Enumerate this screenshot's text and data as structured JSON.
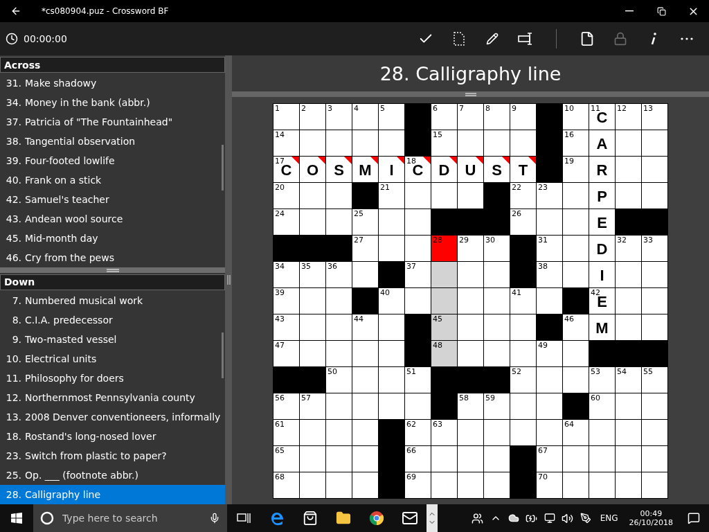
{
  "window": {
    "title": "*cs080904.puz - Crossword BF"
  },
  "toolbar": {
    "timer": "00:00:00",
    "lock_disabled": true
  },
  "across": {
    "heading": "Across",
    "clues": [
      {
        "number": "31.",
        "text": "Make shadowy",
        "selected": false
      },
      {
        "number": "34.",
        "text": "Money in the bank (abbr.)",
        "selected": false
      },
      {
        "number": "37.",
        "text": "Patricia of \"The Fountainhead\"",
        "selected": false
      },
      {
        "number": "38.",
        "text": "Tangential observation",
        "selected": false
      },
      {
        "number": "39.",
        "text": "Four-footed lowlife",
        "selected": false
      },
      {
        "number": "40.",
        "text": "Frank on a stick",
        "selected": false
      },
      {
        "number": "42.",
        "text": "Samuel's teacher",
        "selected": false
      },
      {
        "number": "43.",
        "text": "Andean wool source",
        "selected": false
      },
      {
        "number": "45.",
        "text": "Mid-month day",
        "selected": false
      },
      {
        "number": "46.",
        "text": "Cry from the pews",
        "selected": false
      }
    ]
  },
  "down": {
    "heading": "Down",
    "clues": [
      {
        "number": "7.",
        "text": "Numbered musical work",
        "selected": false
      },
      {
        "number": "8.",
        "text": "C.I.A. predecessor",
        "selected": false
      },
      {
        "number": "9.",
        "text": "Two-masted vessel",
        "selected": false
      },
      {
        "number": "10.",
        "text": "Electrical units",
        "selected": false
      },
      {
        "number": "11.",
        "text": "Philosophy for doers",
        "selected": false
      },
      {
        "number": "12.",
        "text": "Northernmost Pennsylvania county",
        "selected": false
      },
      {
        "number": "13.",
        "text": "2008 Denver conventioneers, informally",
        "selected": false
      },
      {
        "number": "18.",
        "text": "Rostand's long-nosed lover",
        "selected": false
      },
      {
        "number": "23.",
        "text": "Switch from plastic to paper?",
        "selected": false
      },
      {
        "number": "25.",
        "text": "Op. ___ (footnote abbr.)",
        "selected": false
      },
      {
        "number": "28.",
        "text": "Calligraphy line",
        "selected": true
      }
    ]
  },
  "current_clue": "28. Calligraphy line",
  "grid": {
    "rows": [
      [
        {
          "kind": "cell",
          "number": "1",
          "selected": false,
          "highlighted": false,
          "flagged": false
        },
        {
          "kind": "cell",
          "number": "2",
          "selected": false,
          "highlighted": false,
          "flagged": false
        },
        {
          "kind": "cell",
          "number": "3",
          "selected": false,
          "highlighted": false,
          "flagged": false
        },
        {
          "kind": "cell",
          "number": "4",
          "selected": false,
          "highlighted": false,
          "flagged": false
        },
        {
          "kind": "cell",
          "number": "5",
          "selected": false,
          "highlighted": false,
          "flagged": false
        },
        {
          "kind": "block"
        },
        {
          "kind": "cell",
          "number": "6",
          "selected": false,
          "highlighted": false,
          "flagged": false
        },
        {
          "kind": "cell",
          "number": "7",
          "selected": false,
          "highlighted": false,
          "flagged": false
        },
        {
          "kind": "cell",
          "number": "8",
          "selected": false,
          "highlighted": false,
          "flagged": false
        },
        {
          "kind": "cell",
          "number": "9",
          "selected": false,
          "highlighted": false,
          "flagged": false
        },
        {
          "kind": "block"
        },
        {
          "kind": "cell",
          "number": "10",
          "selected": false,
          "highlighted": false,
          "flagged": false
        },
        {
          "kind": "cell",
          "number": "11",
          "letter": "C",
          "selected": false,
          "highlighted": false,
          "flagged": false
        },
        {
          "kind": "cell",
          "number": "12",
          "selected": false,
          "highlighted": false,
          "flagged": false
        },
        {
          "kind": "cell",
          "number": "13",
          "selected": false,
          "highlighted": false,
          "flagged": false
        }
      ],
      [
        {
          "kind": "cell",
          "number": "14",
          "selected": false,
          "highlighted": false,
          "flagged": false
        },
        {
          "kind": "cell",
          "selected": false,
          "highlighted": false,
          "flagged": false
        },
        {
          "kind": "cell",
          "selected": false,
          "highlighted": false,
          "flagged": false
        },
        {
          "kind": "cell",
          "selected": false,
          "highlighted": false,
          "flagged": false
        },
        {
          "kind": "cell",
          "selected": false,
          "highlighted": false,
          "flagged": false
        },
        {
          "kind": "block"
        },
        {
          "kind": "cell",
          "number": "15",
          "selected": false,
          "highlighted": false,
          "flagged": false
        },
        {
          "kind": "cell",
          "selected": false,
          "highlighted": false,
          "flagged": false
        },
        {
          "kind": "cell",
          "selected": false,
          "highlighted": false,
          "flagged": false
        },
        {
          "kind": "cell",
          "selected": false,
          "highlighted": false,
          "flagged": false
        },
        {
          "kind": "block"
        },
        {
          "kind": "cell",
          "number": "16",
          "selected": false,
          "highlighted": false,
          "flagged": false
        },
        {
          "kind": "cell",
          "letter": "A",
          "selected": false,
          "highlighted": false,
          "flagged": false
        },
        {
          "kind": "cell",
          "selected": false,
          "highlighted": false,
          "flagged": false
        },
        {
          "kind": "cell",
          "selected": false,
          "highlighted": false,
          "flagged": false
        }
      ],
      [
        {
          "kind": "cell",
          "number": "17",
          "letter": "C",
          "selected": false,
          "highlighted": false,
          "flagged": true
        },
        {
          "kind": "cell",
          "letter": "O",
          "selected": false,
          "highlighted": false,
          "flagged": true
        },
        {
          "kind": "cell",
          "letter": "S",
          "selected": false,
          "highlighted": false,
          "flagged": true
        },
        {
          "kind": "cell",
          "letter": "M",
          "selected": false,
          "highlighted": false,
          "flagged": true
        },
        {
          "kind": "cell",
          "letter": "I",
          "selected": false,
          "highlighted": false,
          "flagged": true
        },
        {
          "kind": "cell",
          "number": "18",
          "letter": "C",
          "selected": false,
          "highlighted": false,
          "flagged": true
        },
        {
          "kind": "cell",
          "letter": "D",
          "selected": false,
          "highlighted": false,
          "flagged": true
        },
        {
          "kind": "cell",
          "letter": "U",
          "selected": false,
          "highlighted": false,
          "flagged": true
        },
        {
          "kind": "cell",
          "letter": "S",
          "selected": false,
          "highlighted": false,
          "flagged": true
        },
        {
          "kind": "cell",
          "letter": "T",
          "selected": false,
          "highlighted": false,
          "flagged": true
        },
        {
          "kind": "block"
        },
        {
          "kind": "cell",
          "number": "19",
          "selected": false,
          "highlighted": false,
          "flagged": false
        },
        {
          "kind": "cell",
          "letter": "R",
          "selected": false,
          "highlighted": false,
          "flagged": false
        },
        {
          "kind": "cell",
          "selected": false,
          "highlighted": false,
          "flagged": false
        },
        {
          "kind": "cell",
          "selected": false,
          "highlighted": false,
          "flagged": false
        }
      ],
      [
        {
          "kind": "cell",
          "number": "20",
          "selected": false,
          "highlighted": false,
          "flagged": false
        },
        {
          "kind": "cell",
          "selected": false,
          "highlighted": false,
          "flagged": false
        },
        {
          "kind": "cell",
          "selected": false,
          "highlighted": false,
          "flagged": false
        },
        {
          "kind": "block"
        },
        {
          "kind": "cell",
          "number": "21",
          "selected": false,
          "highlighted": false,
          "flagged": false
        },
        {
          "kind": "cell",
          "selected": false,
          "highlighted": false,
          "flagged": false
        },
        {
          "kind": "cell",
          "selected": false,
          "highlighted": false,
          "flagged": false
        },
        {
          "kind": "cell",
          "selected": false,
          "highlighted": false,
          "flagged": false
        },
        {
          "kind": "block"
        },
        {
          "kind": "cell",
          "number": "22",
          "selected": false,
          "highlighted": false,
          "flagged": false
        },
        {
          "kind": "cell",
          "number": "23",
          "selected": false,
          "highlighted": false,
          "flagged": false
        },
        {
          "kind": "cell",
          "selected": false,
          "highlighted": false,
          "flagged": false
        },
        {
          "kind": "cell",
          "letter": "P",
          "selected": false,
          "highlighted": false,
          "flagged": false
        },
        {
          "kind": "cell",
          "selected": false,
          "highlighted": false,
          "flagged": false
        },
        {
          "kind": "cell",
          "selected": false,
          "highlighted": false,
          "flagged": false
        }
      ],
      [
        {
          "kind": "cell",
          "number": "24",
          "selected": false,
          "highlighted": false,
          "flagged": false
        },
        {
          "kind": "cell",
          "selected": false,
          "highlighted": false,
          "flagged": false
        },
        {
          "kind": "cell",
          "selected": false,
          "highlighted": false,
          "flagged": false
        },
        {
          "kind": "cell",
          "number": "25",
          "selected": false,
          "highlighted": false,
          "flagged": false
        },
        {
          "kind": "cell",
          "selected": false,
          "highlighted": false,
          "flagged": false
        },
        {
          "kind": "cell",
          "selected": false,
          "highlighted": false,
          "flagged": false
        },
        {
          "kind": "block"
        },
        {
          "kind": "block"
        },
        {
          "kind": "block"
        },
        {
          "kind": "cell",
          "number": "26",
          "selected": false,
          "highlighted": false,
          "flagged": false
        },
        {
          "kind": "cell",
          "selected": false,
          "highlighted": false,
          "flagged": false
        },
        {
          "kind": "cell",
          "selected": false,
          "highlighted": false,
          "flagged": false
        },
        {
          "kind": "cell",
          "letter": "E",
          "selected": false,
          "highlighted": false,
          "flagged": false
        },
        {
          "kind": "block"
        },
        {
          "kind": "block"
        }
      ],
      [
        {
          "kind": "block"
        },
        {
          "kind": "block"
        },
        {
          "kind": "block"
        },
        {
          "kind": "cell",
          "number": "27",
          "selected": false,
          "highlighted": false,
          "flagged": false
        },
        {
          "kind": "cell",
          "selected": false,
          "highlighted": false,
          "flagged": false
        },
        {
          "kind": "cell",
          "selected": false,
          "highlighted": false,
          "flagged": false
        },
        {
          "kind": "cell",
          "number": "28",
          "selected": true,
          "highlighted": false,
          "flagged": false
        },
        {
          "kind": "cell",
          "number": "29",
          "selected": false,
          "highlighted": false,
          "flagged": false
        },
        {
          "kind": "cell",
          "number": "30",
          "selected": false,
          "highlighted": false,
          "flagged": false
        },
        {
          "kind": "block"
        },
        {
          "kind": "cell",
          "number": "31",
          "selected": false,
          "highlighted": false,
          "flagged": false
        },
        {
          "kind": "cell",
          "selected": false,
          "highlighted": false,
          "flagged": false
        },
        {
          "kind": "cell",
          "letter": "D",
          "selected": false,
          "highlighted": false,
          "flagged": false
        },
        {
          "kind": "cell",
          "number": "32",
          "selected": false,
          "highlighted": false,
          "flagged": false
        },
        {
          "kind": "cell",
          "number": "33",
          "selected": false,
          "highlighted": false,
          "flagged": false
        }
      ],
      [
        {
          "kind": "cell",
          "number": "34",
          "selected": false,
          "highlighted": false,
          "flagged": false
        },
        {
          "kind": "cell",
          "number": "35",
          "selected": false,
          "highlighted": false,
          "flagged": false
        },
        {
          "kind": "cell",
          "number": "36",
          "selected": false,
          "highlighted": false,
          "flagged": false
        },
        {
          "kind": "cell",
          "selected": false,
          "highlighted": false,
          "flagged": false
        },
        {
          "kind": "block"
        },
        {
          "kind": "cell",
          "number": "37",
          "selected": false,
          "highlighted": false,
          "flagged": false
        },
        {
          "kind": "cell",
          "selected": false,
          "highlighted": true,
          "flagged": false
        },
        {
          "kind": "cell",
          "selected": false,
          "highlighted": false,
          "flagged": false
        },
        {
          "kind": "cell",
          "selected": false,
          "highlighted": false,
          "flagged": false
        },
        {
          "kind": "block"
        },
        {
          "kind": "cell",
          "number": "38",
          "selected": false,
          "highlighted": false,
          "flagged": false
        },
        {
          "kind": "cell",
          "selected": false,
          "highlighted": false,
          "flagged": false
        },
        {
          "kind": "cell",
          "letter": "I",
          "selected": false,
          "highlighted": false,
          "flagged": false
        },
        {
          "kind": "cell",
          "selected": false,
          "highlighted": false,
          "flagged": false
        },
        {
          "kind": "cell",
          "selected": false,
          "highlighted": false,
          "flagged": false
        }
      ],
      [
        {
          "kind": "cell",
          "number": "39",
          "selected": false,
          "highlighted": false,
          "flagged": false
        },
        {
          "kind": "cell",
          "selected": false,
          "highlighted": false,
          "flagged": false
        },
        {
          "kind": "cell",
          "selected": false,
          "highlighted": false,
          "flagged": false
        },
        {
          "kind": "block"
        },
        {
          "kind": "cell",
          "number": "40",
          "selected": false,
          "highlighted": false,
          "flagged": false
        },
        {
          "kind": "cell",
          "selected": false,
          "highlighted": false,
          "flagged": false
        },
        {
          "kind": "cell",
          "selected": false,
          "highlighted": true,
          "flagged": false
        },
        {
          "kind": "cell",
          "selected": false,
          "highlighted": false,
          "flagged": false
        },
        {
          "kind": "cell",
          "selected": false,
          "highlighted": false,
          "flagged": false
        },
        {
          "kind": "cell",
          "number": "41",
          "selected": false,
          "highlighted": false,
          "flagged": false
        },
        {
          "kind": "cell",
          "selected": false,
          "highlighted": false,
          "flagged": false
        },
        {
          "kind": "block"
        },
        {
          "kind": "cell",
          "number": "42",
          "letter": "E",
          "selected": false,
          "highlighted": false,
          "flagged": false
        },
        {
          "kind": "cell",
          "selected": false,
          "highlighted": false,
          "flagged": false
        },
        {
          "kind": "cell",
          "selected": false,
          "highlighted": false,
          "flagged": false
        }
      ],
      [
        {
          "kind": "cell",
          "number": "43",
          "selected": false,
          "highlighted": false,
          "flagged": false
        },
        {
          "kind": "cell",
          "selected": false,
          "highlighted": false,
          "flagged": false
        },
        {
          "kind": "cell",
          "selected": false,
          "highlighted": false,
          "flagged": false
        },
        {
          "kind": "cell",
          "number": "44",
          "selected": false,
          "highlighted": false,
          "flagged": false
        },
        {
          "kind": "cell",
          "selected": false,
          "highlighted": false,
          "flagged": false
        },
        {
          "kind": "block"
        },
        {
          "kind": "cell",
          "number": "45",
          "selected": false,
          "highlighted": true,
          "flagged": false
        },
        {
          "kind": "cell",
          "selected": false,
          "highlighted": false,
          "flagged": false
        },
        {
          "kind": "cell",
          "selected": false,
          "highlighted": false,
          "flagged": false
        },
        {
          "kind": "cell",
          "selected": false,
          "highlighted": false,
          "flagged": false
        },
        {
          "kind": "block"
        },
        {
          "kind": "cell",
          "number": "46",
          "selected": false,
          "highlighted": false,
          "flagged": false
        },
        {
          "kind": "cell",
          "letter": "M",
          "selected": false,
          "highlighted": false,
          "flagged": false
        },
        {
          "kind": "cell",
          "selected": false,
          "highlighted": false,
          "flagged": false
        },
        {
          "kind": "cell",
          "selected": false,
          "highlighted": false,
          "flagged": false
        }
      ],
      [
        {
          "kind": "cell",
          "number": "47",
          "selected": false,
          "highlighted": false,
          "flagged": false
        },
        {
          "kind": "cell",
          "selected": false,
          "highlighted": false,
          "flagged": false
        },
        {
          "kind": "cell",
          "selected": false,
          "highlighted": false,
          "flagged": false
        },
        {
          "kind": "cell",
          "selected": false,
          "highlighted": false,
          "flagged": false
        },
        {
          "kind": "cell",
          "selected": false,
          "highlighted": false,
          "flagged": false
        },
        {
          "kind": "block"
        },
        {
          "kind": "cell",
          "number": "48",
          "selected": false,
          "highlighted": true,
          "flagged": false
        },
        {
          "kind": "cell",
          "selected": false,
          "highlighted": false,
          "flagged": false
        },
        {
          "kind": "cell",
          "selected": false,
          "highlighted": false,
          "flagged": false
        },
        {
          "kind": "cell",
          "selected": false,
          "highlighted": false,
          "flagged": false
        },
        {
          "kind": "cell",
          "number": "49",
          "selected": false,
          "highlighted": false,
          "flagged": false
        },
        {
          "kind": "cell",
          "selected": false,
          "highlighted": false,
          "flagged": false
        },
        {
          "kind": "block"
        },
        {
          "kind": "block"
        },
        {
          "kind": "block"
        }
      ],
      [
        {
          "kind": "block"
        },
        {
          "kind": "block"
        },
        {
          "kind": "cell",
          "number": "50",
          "selected": false,
          "highlighted": false,
          "flagged": false
        },
        {
          "kind": "cell",
          "selected": false,
          "highlighted": false,
          "flagged": false
        },
        {
          "kind": "cell",
          "selected": false,
          "highlighted": false,
          "flagged": false
        },
        {
          "kind": "cell",
          "number": "51",
          "selected": false,
          "highlighted": false,
          "flagged": false
        },
        {
          "kind": "block"
        },
        {
          "kind": "block"
        },
        {
          "kind": "block"
        },
        {
          "kind": "cell",
          "number": "52",
          "selected": false,
          "highlighted": false,
          "flagged": false
        },
        {
          "kind": "cell",
          "selected": false,
          "highlighted": false,
          "flagged": false
        },
        {
          "kind": "cell",
          "selected": false,
          "highlighted": false,
          "flagged": false
        },
        {
          "kind": "cell",
          "number": "53",
          "selected": false,
          "highlighted": false,
          "flagged": false
        },
        {
          "kind": "cell",
          "number": "54",
          "selected": false,
          "highlighted": false,
          "flagged": false
        },
        {
          "kind": "cell",
          "number": "55",
          "selected": false,
          "highlighted": false,
          "flagged": false
        }
      ],
      [
        {
          "kind": "cell",
          "number": "56",
          "selected": false,
          "highlighted": false,
          "flagged": false
        },
        {
          "kind": "cell",
          "number": "57",
          "selected": false,
          "highlighted": false,
          "flagged": false
        },
        {
          "kind": "cell",
          "selected": false,
          "highlighted": false,
          "flagged": false
        },
        {
          "kind": "cell",
          "selected": false,
          "highlighted": false,
          "flagged": false
        },
        {
          "kind": "cell",
          "selected": false,
          "highlighted": false,
          "flagged": false
        },
        {
          "kind": "cell",
          "selected": false,
          "highlighted": false,
          "flagged": false
        },
        {
          "kind": "block"
        },
        {
          "kind": "cell",
          "number": "58",
          "selected": false,
          "highlighted": false,
          "flagged": false
        },
        {
          "kind": "cell",
          "number": "59",
          "selected": false,
          "highlighted": false,
          "flagged": false
        },
        {
          "kind": "cell",
          "selected": false,
          "highlighted": false,
          "flagged": false
        },
        {
          "kind": "cell",
          "selected": false,
          "highlighted": false,
          "flagged": false
        },
        {
          "kind": "block"
        },
        {
          "kind": "cell",
          "number": "60",
          "selected": false,
          "highlighted": false,
          "flagged": false
        },
        {
          "kind": "cell",
          "selected": false,
          "highlighted": false,
          "flagged": false
        },
        {
          "kind": "cell",
          "selected": false,
          "highlighted": false,
          "flagged": false
        }
      ],
      [
        {
          "kind": "cell",
          "number": "61",
          "selected": false,
          "highlighted": false,
          "flagged": false
        },
        {
          "kind": "cell",
          "selected": false,
          "highlighted": false,
          "flagged": false
        },
        {
          "kind": "cell",
          "selected": false,
          "highlighted": false,
          "flagged": false
        },
        {
          "kind": "cell",
          "selected": false,
          "highlighted": false,
          "flagged": false
        },
        {
          "kind": "block"
        },
        {
          "kind": "cell",
          "number": "62",
          "selected": false,
          "highlighted": false,
          "flagged": false
        },
        {
          "kind": "cell",
          "number": "63",
          "selected": false,
          "highlighted": false,
          "flagged": false
        },
        {
          "kind": "cell",
          "selected": false,
          "highlighted": false,
          "flagged": false
        },
        {
          "kind": "cell",
          "selected": false,
          "highlighted": false,
          "flagged": false
        },
        {
          "kind": "cell",
          "selected": false,
          "highlighted": false,
          "flagged": false
        },
        {
          "kind": "cell",
          "selected": false,
          "highlighted": false,
          "flagged": false
        },
        {
          "kind": "cell",
          "number": "64",
          "selected": false,
          "highlighted": false,
          "flagged": false
        },
        {
          "kind": "cell",
          "selected": false,
          "highlighted": false,
          "flagged": false
        },
        {
          "kind": "cell",
          "selected": false,
          "highlighted": false,
          "flagged": false
        },
        {
          "kind": "cell",
          "selected": false,
          "highlighted": false,
          "flagged": false
        }
      ],
      [
        {
          "kind": "cell",
          "number": "65",
          "selected": false,
          "highlighted": false,
          "flagged": false
        },
        {
          "kind": "cell",
          "selected": false,
          "highlighted": false,
          "flagged": false
        },
        {
          "kind": "cell",
          "selected": false,
          "highlighted": false,
          "flagged": false
        },
        {
          "kind": "cell",
          "selected": false,
          "highlighted": false,
          "flagged": false
        },
        {
          "kind": "block"
        },
        {
          "kind": "cell",
          "number": "66",
          "selected": false,
          "highlighted": false,
          "flagged": false
        },
        {
          "kind": "cell",
          "selected": false,
          "highlighted": false,
          "flagged": false
        },
        {
          "kind": "cell",
          "selected": false,
          "highlighted": false,
          "flagged": false
        },
        {
          "kind": "cell",
          "selected": false,
          "highlighted": false,
          "flagged": false
        },
        {
          "kind": "block"
        },
        {
          "kind": "cell",
          "number": "67",
          "selected": false,
          "highlighted": false,
          "flagged": false
        },
        {
          "kind": "cell",
          "selected": false,
          "highlighted": false,
          "flagged": false
        },
        {
          "kind": "cell",
          "selected": false,
          "highlighted": false,
          "flagged": false
        },
        {
          "kind": "cell",
          "selected": false,
          "highlighted": false,
          "flagged": false
        },
        {
          "kind": "cell",
          "selected": false,
          "highlighted": false,
          "flagged": false
        }
      ],
      [
        {
          "kind": "cell",
          "number": "68",
          "selected": false,
          "highlighted": false,
          "flagged": false
        },
        {
          "kind": "cell",
          "selected": false,
          "highlighted": false,
          "flagged": false
        },
        {
          "kind": "cell",
          "selected": false,
          "highlighted": false,
          "flagged": false
        },
        {
          "kind": "cell",
          "selected": false,
          "highlighted": false,
          "flagged": false
        },
        {
          "kind": "block"
        },
        {
          "kind": "cell",
          "number": "69",
          "selected": false,
          "highlighted": false,
          "flagged": false
        },
        {
          "kind": "cell",
          "selected": false,
          "highlighted": false,
          "flagged": false
        },
        {
          "kind": "cell",
          "selected": false,
          "highlighted": false,
          "flagged": false
        },
        {
          "kind": "cell",
          "selected": false,
          "highlighted": false,
          "flagged": false
        },
        {
          "kind": "block"
        },
        {
          "kind": "cell",
          "number": "70",
          "selected": false,
          "highlighted": false,
          "flagged": false
        },
        {
          "kind": "cell",
          "selected": false,
          "highlighted": false,
          "flagged": false
        },
        {
          "kind": "cell",
          "selected": false,
          "highlighted": false,
          "flagged": false
        },
        {
          "kind": "cell",
          "selected": false,
          "highlighted": false,
          "flagged": false
        },
        {
          "kind": "cell",
          "selected": false,
          "highlighted": false,
          "flagged": false
        }
      ]
    ]
  },
  "taskbar": {
    "search_placeholder": "Type here to search",
    "language": "ENG",
    "time": "00:49",
    "date": "26/10/2018"
  }
}
